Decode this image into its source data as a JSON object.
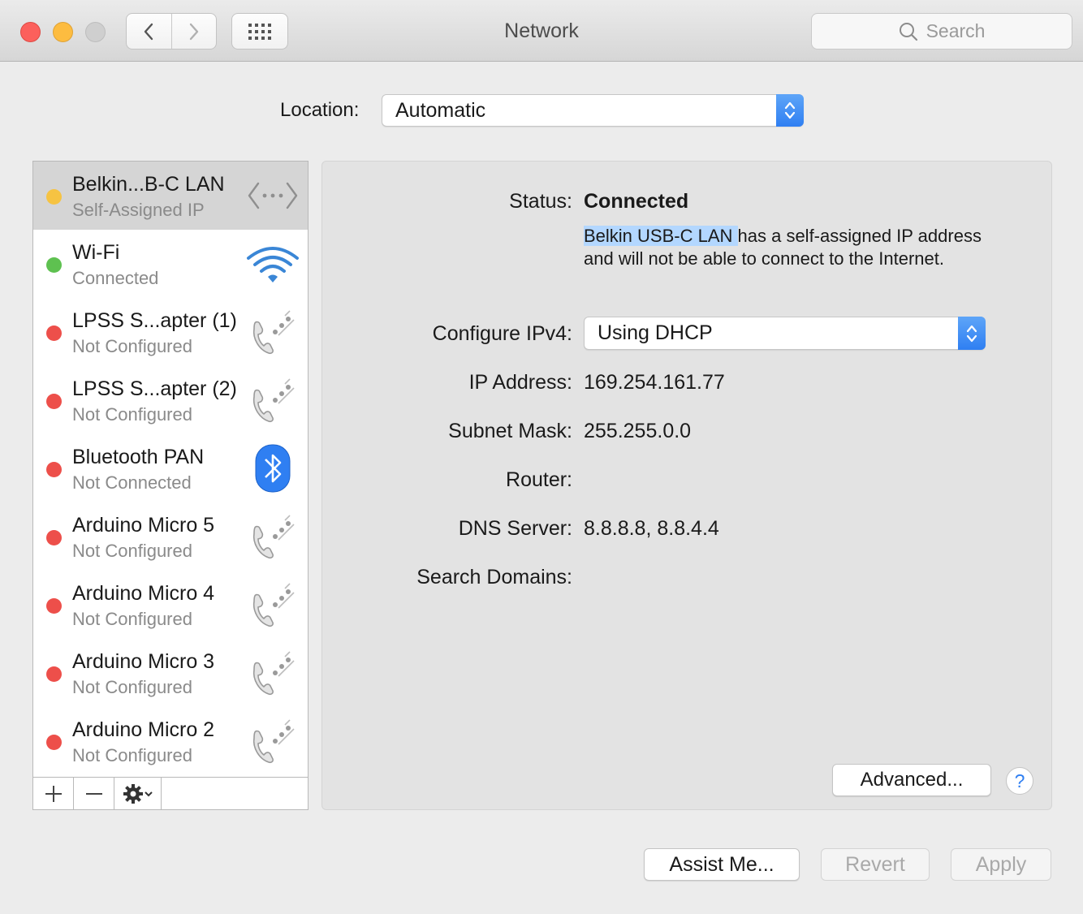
{
  "window": {
    "title": "Network"
  },
  "toolbar": {
    "search_placeholder": "Search"
  },
  "location": {
    "label": "Location:",
    "value": "Automatic"
  },
  "services": [
    {
      "name": "Belkin...B-C LAN",
      "status": "Self-Assigned IP",
      "state": "yellow",
      "icon": "ethernet-icon",
      "selected": true
    },
    {
      "name": "Wi-Fi",
      "status": "Connected",
      "state": "green",
      "icon": "wifi-icon"
    },
    {
      "name": "LPSS S...apter (1)",
      "status": "Not Configured",
      "state": "red",
      "icon": "phone-icon"
    },
    {
      "name": "LPSS S...apter (2)",
      "status": "Not Configured",
      "state": "red",
      "icon": "phone-icon"
    },
    {
      "name": "Bluetooth PAN",
      "status": "Not Connected",
      "state": "red",
      "icon": "bluetooth-icon"
    },
    {
      "name": "Arduino Micro 5",
      "status": "Not Configured",
      "state": "red",
      "icon": "phone-icon"
    },
    {
      "name": "Arduino Micro 4",
      "status": "Not Configured",
      "state": "red",
      "icon": "phone-icon"
    },
    {
      "name": "Arduino Micro 3",
      "status": "Not Configured",
      "state": "red",
      "icon": "phone-icon"
    },
    {
      "name": "Arduino Micro 2",
      "status": "Not Configured",
      "state": "red",
      "icon": "phone-icon"
    }
  ],
  "status_colors": {
    "yellow": "#f6c342",
    "green": "#5ec150",
    "red": "#ed4f4a"
  },
  "detail": {
    "status_label": "Status:",
    "status_value": "Connected",
    "desc_highlight": "Belkin USB-C LAN ",
    "desc_rest": "has a self-assigned IP address and will not be able to connect to the Internet.",
    "configure_label": "Configure IPv4:",
    "configure_value": "Using DHCP",
    "ip_label": "IP Address:",
    "ip_value": "169.254.161.77",
    "subnet_label": "Subnet Mask:",
    "subnet_value": "255.255.0.0",
    "router_label": "Router:",
    "router_value": "",
    "dns_label": "DNS Server:",
    "dns_value": "8.8.8.8, 8.8.4.4",
    "search_domains_label": "Search Domains:",
    "advanced_label": "Advanced...",
    "help_label": "?"
  },
  "buttons": {
    "assist": "Assist Me...",
    "revert": "Revert",
    "apply": "Apply"
  },
  "accent": "#2f7ff2"
}
